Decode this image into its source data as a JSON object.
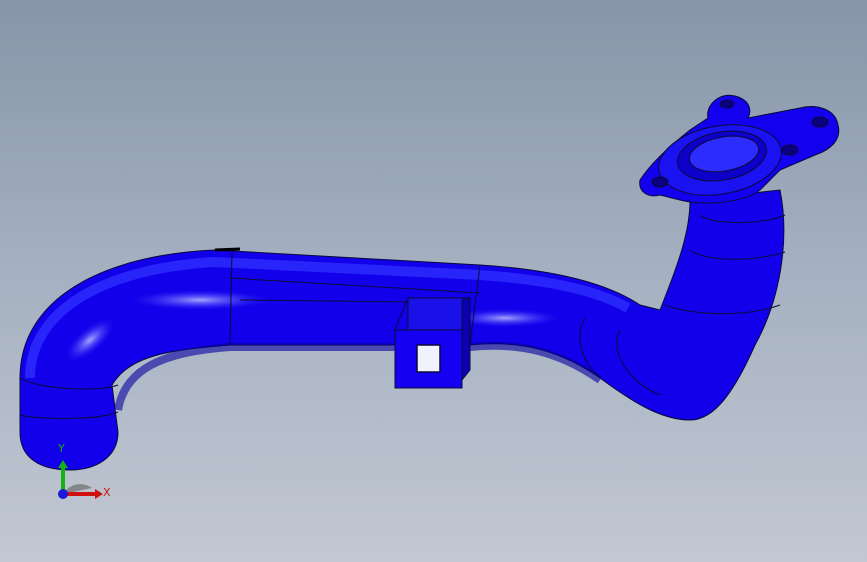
{
  "viewport": {
    "background_top": "#8795a8",
    "background_bottom": "#c2c8d3"
  },
  "model": {
    "part_color": "#1400f0",
    "edge_color": "#0b0a3a",
    "icon": "bent-pipe-with-flange-and-bracket"
  },
  "triad": {
    "y_label": "Y",
    "x_label": "X",
    "y_color": "#12b312",
    "x_color": "#d01010",
    "z_color": "#1a1ad8"
  }
}
